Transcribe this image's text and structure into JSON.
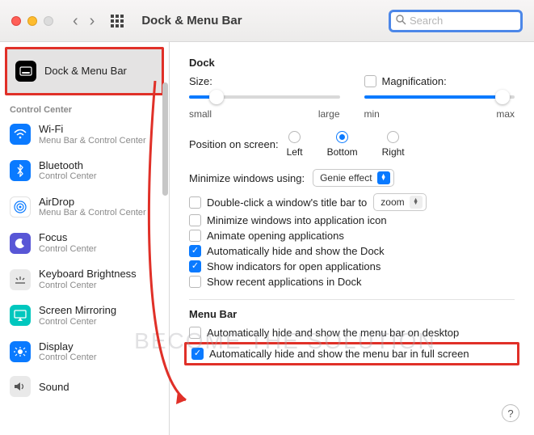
{
  "toolbar": {
    "title": "Dock & Menu Bar",
    "search_placeholder": "Search",
    "search_value": ""
  },
  "sidebar": {
    "selected": {
      "label": "Dock & Menu Bar"
    },
    "section_label": "Control Center",
    "items": [
      {
        "name": "Wi-Fi",
        "sub": "Menu Bar & Control Center"
      },
      {
        "name": "Bluetooth",
        "sub": "Control Center"
      },
      {
        "name": "AirDrop",
        "sub": "Menu Bar & Control Center"
      },
      {
        "name": "Focus",
        "sub": "Control Center"
      },
      {
        "name": "Keyboard Brightness",
        "sub": "Control Center"
      },
      {
        "name": "Screen Mirroring",
        "sub": "Control Center"
      },
      {
        "name": "Display",
        "sub": "Control Center"
      },
      {
        "name": "Sound",
        "sub": ""
      }
    ]
  },
  "dock": {
    "heading": "Dock",
    "size_label": "Size:",
    "size_min": "small",
    "size_max": "large",
    "size_value_pct": 18,
    "mag_label": "Magnification:",
    "mag_checked": false,
    "mag_min": "min",
    "mag_max": "max",
    "mag_value_pct": 92,
    "position_label": "Position on screen:",
    "position_options": {
      "left": "Left",
      "bottom": "Bottom",
      "right": "Right"
    },
    "position_value": "bottom",
    "minimize_label": "Minimize windows using:",
    "minimize_value": "Genie effect",
    "dbl_click_prefix": "Double-click a window's title bar to",
    "dbl_click_value": "zoom",
    "dbl_click_checked": false,
    "min_into_icon": "Minimize windows into application icon",
    "min_into_icon_checked": false,
    "animate": "Animate opening applications",
    "animate_checked": false,
    "autohide_dock": "Automatically hide and show the Dock",
    "autohide_dock_checked": true,
    "indicators": "Show indicators for open applications",
    "indicators_checked": true,
    "recent": "Show recent applications in Dock",
    "recent_checked": false
  },
  "menubar": {
    "heading": "Menu Bar",
    "autohide_desktop": "Automatically hide and show the menu bar on desktop",
    "autohide_desktop_checked": false,
    "autohide_fullscreen": "Automatically hide and show the menu bar in full screen",
    "autohide_fullscreen_checked": true
  },
  "help_label": "?",
  "watermark": "BECOME THE SOLUTION"
}
